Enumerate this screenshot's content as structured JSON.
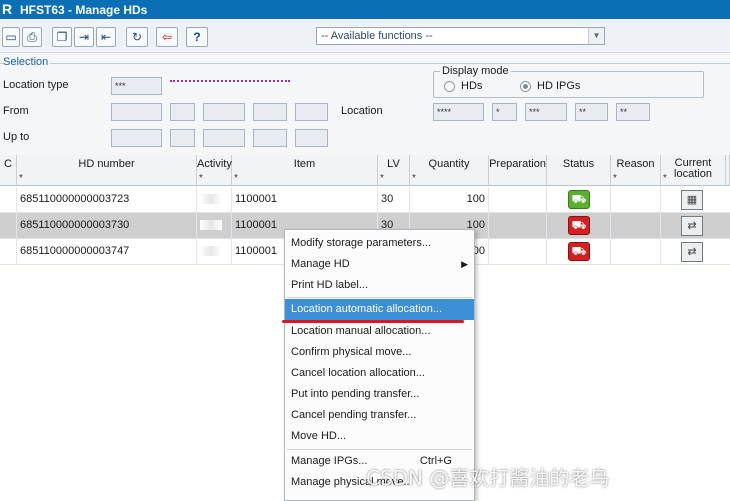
{
  "window": {
    "title": "HFST63 - Manage HDs"
  },
  "toolbar": {
    "functions_value": "-- Available functions --",
    "buttons": [
      "new-icon",
      "print-icon",
      "copy-icon",
      "move-in-icon",
      "move-out-icon",
      "refresh-icon",
      "exit-icon",
      "help-icon"
    ],
    "help_label": "?"
  },
  "selection": {
    "legend": "Selection",
    "location_type_label": "Location type",
    "location_type_value": "***",
    "from_label": "From",
    "upto_label": "Up to",
    "location_label": "Location",
    "location_values": [
      "****",
      "*",
      "***",
      "**",
      "**"
    ],
    "display_mode": {
      "legend": "Display mode",
      "options": [
        {
          "label": "HDs",
          "selected": false
        },
        {
          "label": "HD IPGs",
          "selected": true
        }
      ]
    }
  },
  "grid": {
    "columns": [
      "C",
      "HD number",
      "Activity",
      "Item",
      "LV",
      "Quantity",
      "Preparation",
      "Status",
      "Reason",
      "Current location"
    ],
    "column_filters": [
      "",
      "*",
      "*",
      "*",
      "*",
      "*",
      "",
      "",
      "*",
      "*"
    ],
    "rows": [
      {
        "hd_number": "685110000000003723",
        "item": "1100001",
        "lv": "30",
        "quantity": "100",
        "status": "green",
        "selected": false
      },
      {
        "hd_number": "685110000000003730",
        "item": "1100001",
        "lv": "30",
        "quantity": "100",
        "status": "red",
        "selected": true
      },
      {
        "hd_number": "685110000000003747",
        "item": "1100001",
        "lv": "",
        "quantity": "00",
        "status": "red",
        "selected": false
      }
    ]
  },
  "context_menu": {
    "items": [
      {
        "label": "Modify storage parameters...",
        "shortcut": "",
        "submenu": false
      },
      {
        "label": "Manage HD",
        "shortcut": "",
        "submenu": true
      },
      {
        "label": "Print HD label...",
        "shortcut": "",
        "submenu": false
      },
      {
        "label": "Location automatic allocation...",
        "shortcut": "",
        "submenu": false,
        "highlighted": true
      },
      {
        "label": "Location manual allocation...",
        "shortcut": "",
        "submenu": false
      },
      {
        "label": "Confirm physical move...",
        "shortcut": "",
        "submenu": false
      },
      {
        "label": "Cancel location allocation...",
        "shortcut": "",
        "submenu": false
      },
      {
        "label": "Put into pending transfer...",
        "shortcut": "",
        "submenu": false
      },
      {
        "label": "Cancel pending transfer...",
        "shortcut": "",
        "submenu": false
      },
      {
        "label": "Move HD...",
        "shortcut": "",
        "submenu": false
      },
      {
        "label": "Manage IPGs...",
        "shortcut": "Ctrl+G",
        "submenu": false
      },
      {
        "label": "Manage physical move...",
        "shortcut": "",
        "submenu": false
      }
    ]
  },
  "colors": {
    "title_bar": "#0a6fb4",
    "menu_highlight": "#3d8fd6",
    "status_green": "#5ab030",
    "status_red": "#d42020",
    "annotation_underline": "#e0141c"
  },
  "watermark": "CSDN @喜欢打酱油的老鸟"
}
